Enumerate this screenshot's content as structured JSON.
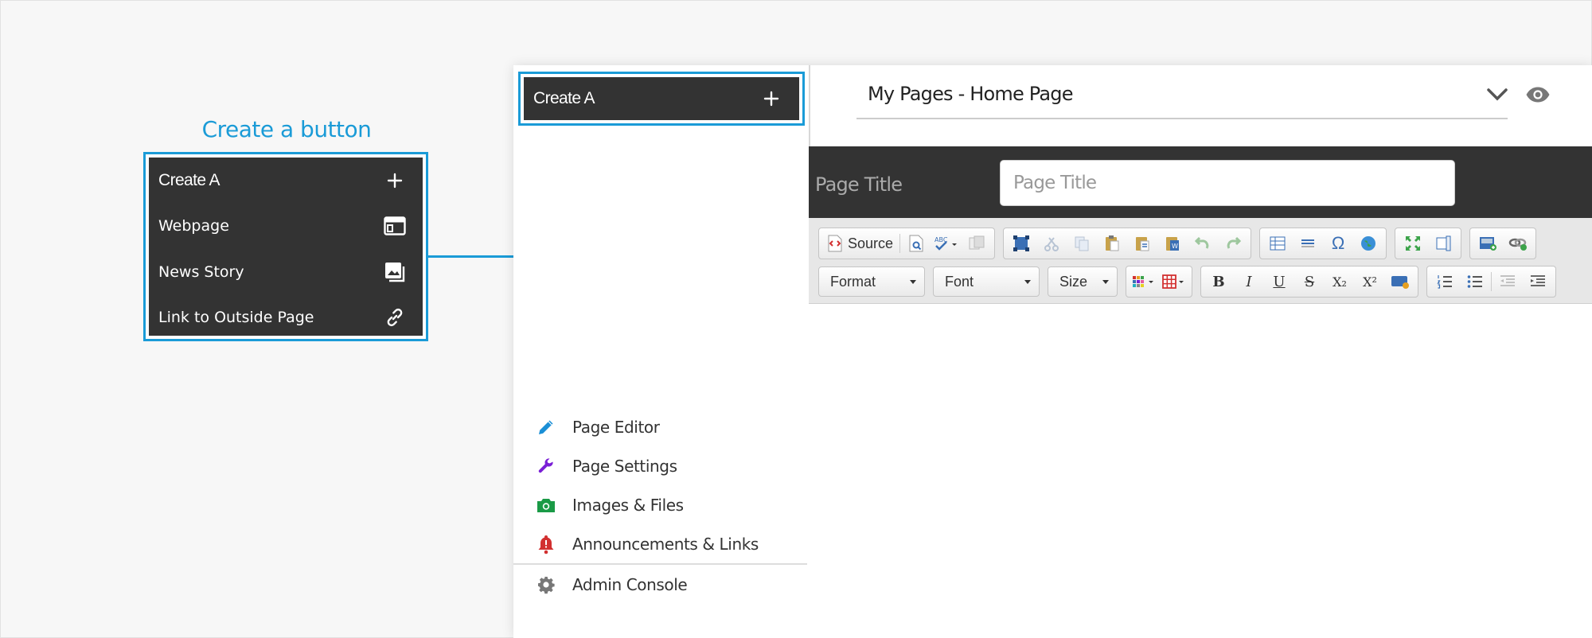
{
  "annotation": {
    "title": "Create a button"
  },
  "dropdown": {
    "header_label": "Create A",
    "items": [
      {
        "label": "Webpage",
        "icon": "webpage-icon"
      },
      {
        "label": "News Story",
        "icon": "image-gallery-icon"
      },
      {
        "label": "Link to Outside Page",
        "icon": "link-icon"
      }
    ]
  },
  "sidebar": {
    "create_label": "Create A",
    "nav": [
      {
        "label": "Page Editor",
        "icon": "pencil-icon",
        "color": "#1a8fd6"
      },
      {
        "label": "Page Settings",
        "icon": "wrench-icon",
        "color": "#7a1fd6"
      },
      {
        "label": "Images & Files",
        "icon": "camera-icon",
        "color": "#1a9a46"
      },
      {
        "label": "Announcements & Links",
        "icon": "bell-icon",
        "color": "#d23030"
      },
      {
        "label": "Admin Console",
        "icon": "gear-icon",
        "color": "#777777"
      }
    ]
  },
  "topbar": {
    "page_select": "My Pages - Home Page"
  },
  "page_title": {
    "label": "Page Title",
    "placeholder": "Page Title"
  },
  "toolbar": {
    "source_label": "Source",
    "format_label": "Format",
    "font_label": "Font",
    "size_label": "Size",
    "omega": "Ω",
    "bold": "B",
    "italic": "I",
    "underline": "U",
    "strike": "S",
    "subscript": "X₂",
    "superscript": "X²"
  },
  "colors": {
    "accent": "#1a9bd7",
    "dark": "#333333"
  }
}
